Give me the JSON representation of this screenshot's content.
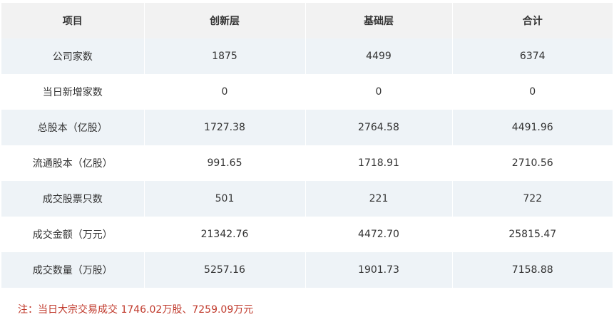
{
  "table": {
    "headers": [
      "项目",
      "创新层",
      "基础层",
      "合计"
    ],
    "rows": [
      [
        "公司家数",
        "1875",
        "4499",
        "6374"
      ],
      [
        "当日新增家数",
        "0",
        "0",
        "0"
      ],
      [
        "总股本（亿股）",
        "1727.38",
        "2764.58",
        "4491.96"
      ],
      [
        "流通股本（亿股）",
        "991.65",
        "1718.91",
        "2710.56"
      ],
      [
        "成交股票只数",
        "501",
        "221",
        "722"
      ],
      [
        "成交金额（万元）",
        "21342.76",
        "4472.70",
        "25815.47"
      ],
      [
        "成交数量（万股）",
        "5257.16",
        "1901.73",
        "7158.88"
      ]
    ]
  },
  "footnote": "注：当日大宗交易成交 1746.02万股、7259.09万元",
  "colors": {
    "header_bg": "#f2f2f2",
    "stripe_bg": "#eef3f7",
    "footnote_text": "#c0392b"
  }
}
